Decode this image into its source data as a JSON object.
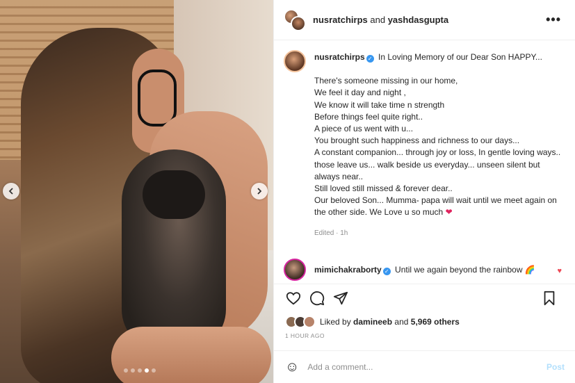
{
  "post": {
    "photo_alt": "",
    "carousel": {
      "slide_count": 5,
      "active_index": 3
    }
  },
  "header": {
    "user1": "nusratchirps",
    "conjunction": "and",
    "user2": "yashdasgupta",
    "more": "•••"
  },
  "caption": {
    "username": "nusratchirps",
    "verified": "✓",
    "first_line": "In Loving Memory of our Dear Son HAPPY...",
    "lines": [
      "There's someone missing in our home,",
      "We feel it day and night ,",
      "We know it will take time n strength",
      "Before things feel quite right..",
      "A piece of us went with u...",
      "You brought such happiness and richness to our days...",
      "A constant companion... through joy or loss, In gentle loving ways..",
      "those leave us... walk beside us everyday... unseen silent but always near..",
      "Still loved still missed & forever dear..",
      "Our beloved Son... Mumma- papa will wait until we meet again on the other side. We Love u so much"
    ],
    "heart": "❤",
    "edited": "Edited · 1h"
  },
  "comment": {
    "username": "mimichakraborty",
    "text": "Until we again beyond the rainbow",
    "emoji": "🌈",
    "like": "♥"
  },
  "likes": {
    "prefix": "Liked by",
    "user": "damineeb",
    "and": "and",
    "count": "5,969 others"
  },
  "timestamp": "1 HOUR AGO",
  "add_comment": {
    "emoji": "☺",
    "placeholder": "Add a comment...",
    "post": "Post"
  },
  "icons": [
    "heart-icon",
    "comment-icon",
    "share-icon",
    "bookmark-icon",
    "more-icon",
    "emoji-icon"
  ]
}
